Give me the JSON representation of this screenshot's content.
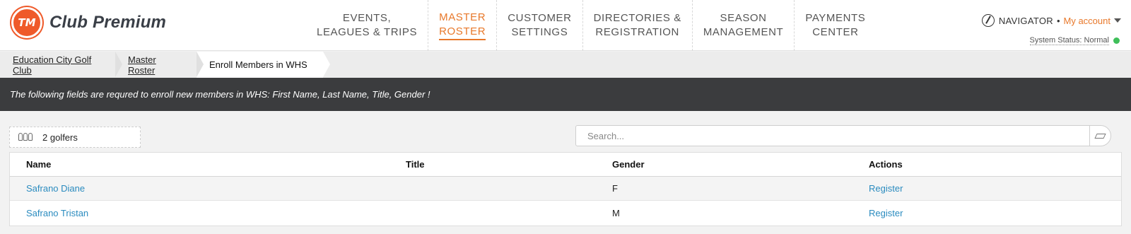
{
  "brand": {
    "badge": "TM",
    "name": "Club Premium"
  },
  "nav": [
    {
      "line1": "EVENTS,",
      "line2": "LEAGUES & TRIPS",
      "active": false
    },
    {
      "line1": "MASTER",
      "line2": "ROSTER",
      "active": true
    },
    {
      "line1": "CUSTOMER",
      "line2": "SETTINGS",
      "active": false
    },
    {
      "line1": "DIRECTORIES &",
      "line2": "REGISTRATION",
      "active": false
    },
    {
      "line1": "SEASON",
      "line2": "MANAGEMENT",
      "active": false
    },
    {
      "line1": "PAYMENTS",
      "line2": "CENTER",
      "active": false
    }
  ],
  "account": {
    "navigator": "NAVIGATOR",
    "separator": "•",
    "my_account": "My account",
    "status": "System Status: Normal"
  },
  "breadcrumb": [
    "Education City Golf Club",
    "Master Roster",
    "Enroll Members in WHS"
  ],
  "banner": "The following fields are requred to enroll new members in WHS: First Name, Last Name, Title, Gender !",
  "count_label": "2 golfers",
  "search": {
    "placeholder": "Search...",
    "value": ""
  },
  "table": {
    "headers": [
      "Name",
      "Title",
      "Gender",
      "Actions"
    ],
    "rows": [
      {
        "name": "Safrano Diane",
        "title": "",
        "gender": "F",
        "action": "Register"
      },
      {
        "name": "Safrano Tristan",
        "title": "",
        "gender": "M",
        "action": "Register"
      }
    ]
  },
  "colors": {
    "accent": "#e8782a",
    "link": "#2a8bbf",
    "banner_bg": "#3b3c3e",
    "status_ok": "#3fbf5a",
    "logo": "#ef5a2a"
  }
}
